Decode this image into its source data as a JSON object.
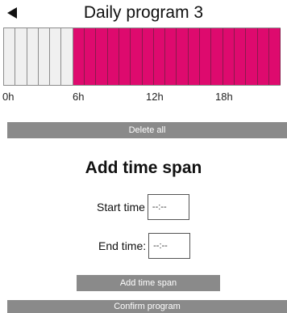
{
  "header": {
    "title": "Daily program 3",
    "back_icon": "triangle-left-icon"
  },
  "schedule": {
    "slots": [
      0,
      0,
      0,
      0,
      0,
      0,
      1,
      1,
      1,
      1,
      1,
      1,
      1,
      1,
      1,
      1,
      1,
      1,
      1,
      1,
      1,
      1,
      1,
      1
    ],
    "active_color": "#de0a6e",
    "inactive_color": "#f0f0f0",
    "hour_labels": [
      {
        "text": "0h",
        "hour": 0
      },
      {
        "text": "6h",
        "hour": 6
      },
      {
        "text": "12h",
        "hour": 12
      },
      {
        "text": "18h",
        "hour": 18
      }
    ]
  },
  "actions": {
    "delete_all": "Delete all"
  },
  "add_span": {
    "title": "Add time span",
    "start_label": "Start time",
    "start_value": "--:--",
    "end_label": "End time:",
    "end_value": "--:--",
    "add_button": "Add time span"
  },
  "footer": {
    "confirm": "Confirm program"
  }
}
